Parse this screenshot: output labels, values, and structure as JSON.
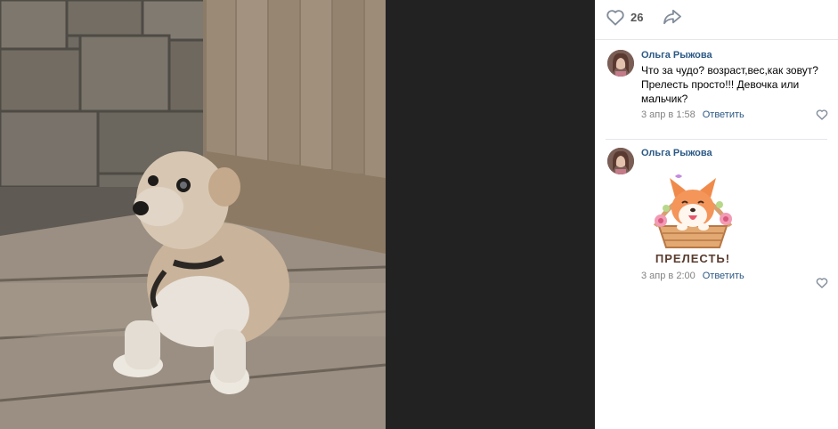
{
  "post": {
    "likes": "26",
    "like_icon": "heart-outline-icon",
    "share_icon": "share-arrow-icon"
  },
  "comments": [
    {
      "author": "Ольга Рыжова",
      "text": "Что за чудо? возраст,вес,как зовут? Прелесть просто!!! Девочка или мальчик?",
      "time": "3 апр в 1:58",
      "reply_label": "Ответить"
    },
    {
      "author": "Ольга Рыжова",
      "sticker_text": "ПРЕЛЕСТЬ!",
      "time": "3 апр в 2:00",
      "reply_label": "Ответить"
    }
  ],
  "colors": {
    "link": "#2a5885",
    "meta": "#828282",
    "viewer_bg": "#222222"
  }
}
